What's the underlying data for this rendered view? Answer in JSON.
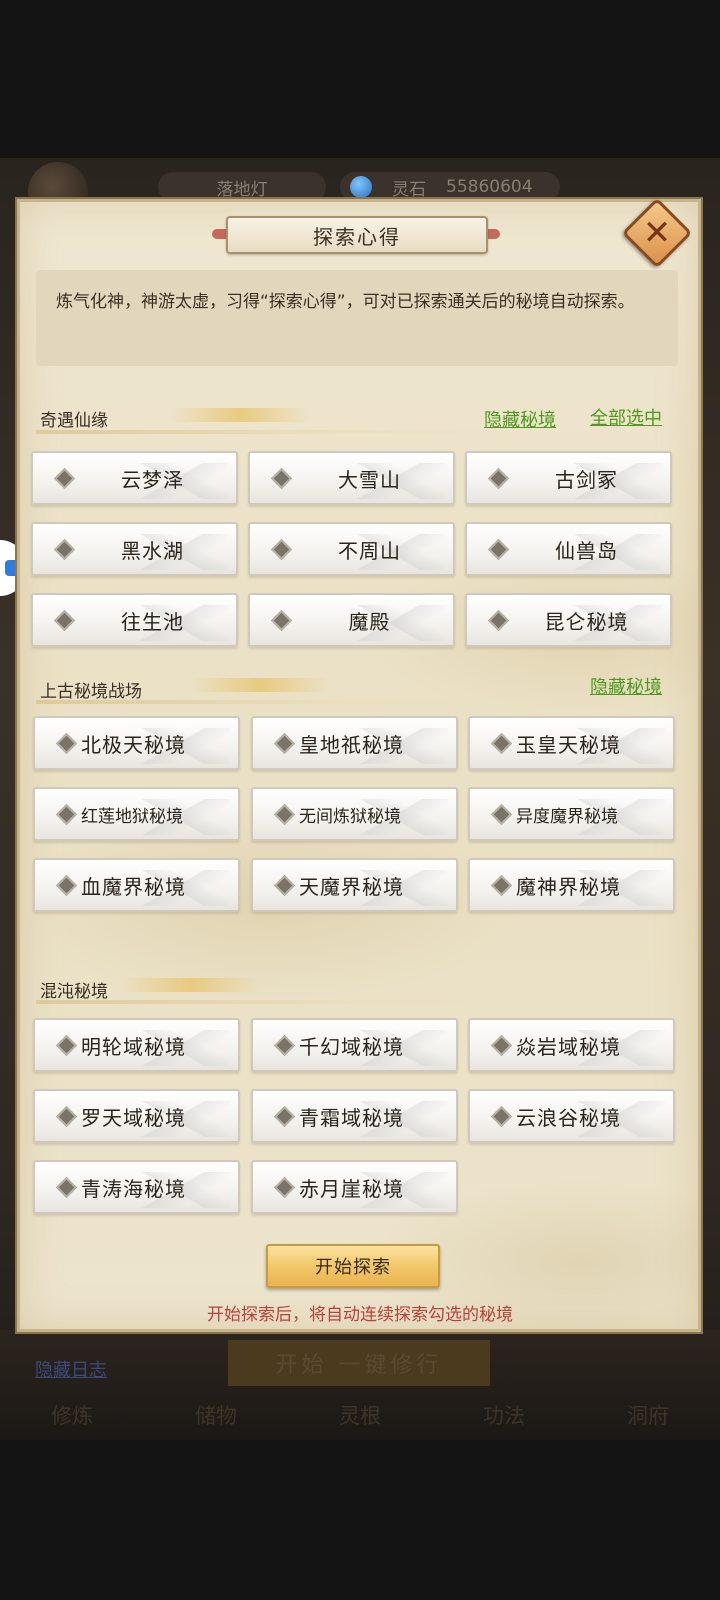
{
  "background": {
    "lamp_label": "落地灯",
    "stone_label": "灵石",
    "stone_value": "55860604",
    "log_link": "隐藏日志",
    "start_cultivate": "开始 一键修行",
    "nav": [
      "修炼",
      "储物",
      "灵根",
      "功法",
      "洞府"
    ]
  },
  "dialog": {
    "title": "探索心得",
    "intro": "炼气化神，神游太虚，习得“探索心得”，可对已探索通关后的秘境自动探索。",
    "sections": [
      {
        "title": "奇遇仙缘",
        "hide_link": "隐藏秘境",
        "select_all_link": "全部选中",
        "items": [
          "云梦泽",
          "大雪山",
          "古剑冢",
          "黑水湖",
          "不周山",
          "仙兽岛",
          "往生池",
          "魔殿",
          "昆仑秘境"
        ]
      },
      {
        "title": "上古秘境战场",
        "hide_link": "隐藏秘境",
        "items": [
          "北极天秘境",
          "皇地祇秘境",
          "玉皇天秘境",
          "红莲地狱秘境",
          "无间炼狱秘境",
          "异度魔界秘境",
          "血魔界秘境",
          "天魔界秘境",
          "魔神界秘境"
        ]
      },
      {
        "title": "混沌秘境",
        "items": [
          "明轮域秘境",
          "千幻域秘境",
          "焱岩域秘境",
          "罗天域秘境",
          "青霜域秘境",
          "云浪谷秘境",
          "青涛海秘境",
          "赤月崖秘境"
        ]
      }
    ],
    "start_button": "开始探索",
    "start_hint": "开始探索后，将自动连续探索勾选的秘境"
  },
  "colors": {
    "link_green": "#4f9a1e",
    "hint_red": "#b8413a",
    "start_gold": "#f2c86a"
  }
}
